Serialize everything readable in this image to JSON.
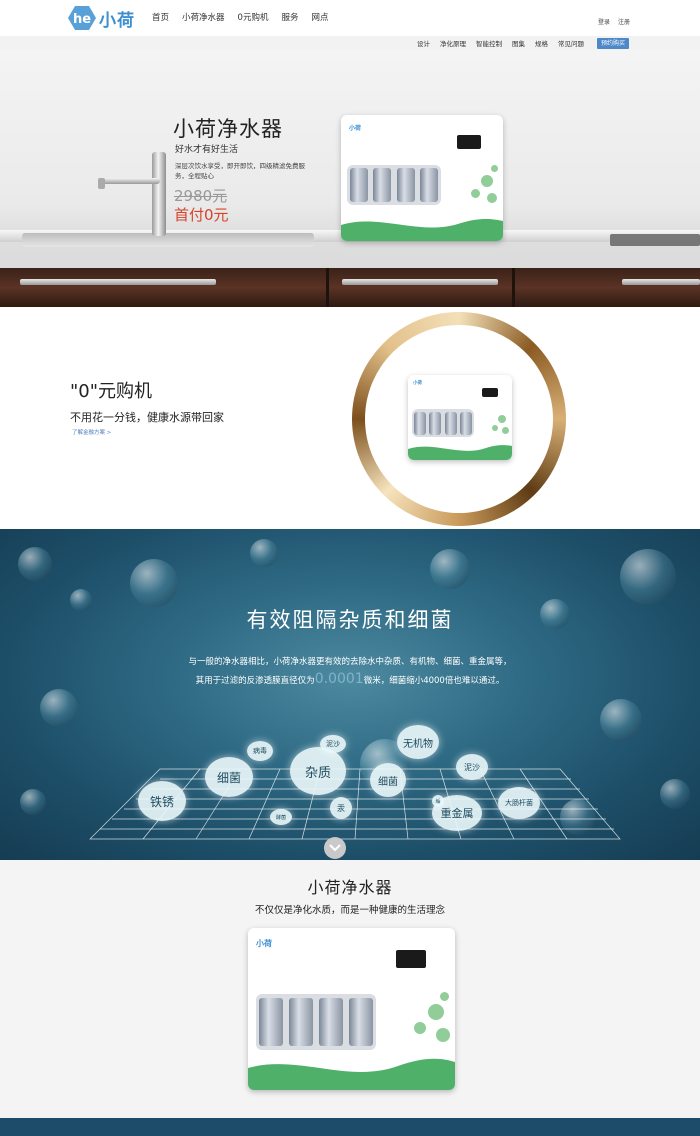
{
  "header": {
    "logo_text": "小荷",
    "nav": [
      "首页",
      "小荷净水器",
      "0元购机",
      "服务",
      "网点"
    ],
    "login": "登录",
    "register": "注册"
  },
  "subnav": {
    "items": [
      "设计",
      "净化原理",
      "智能控制",
      "图集",
      "规格",
      "常见问题"
    ],
    "book_button": "预约购买"
  },
  "hero": {
    "title": "小荷净水器",
    "subtitle": "好水才有好生活",
    "description": "深层次饮水享受，即开即饮，四级精滤免费服务，全程贴心",
    "price_old": "2980元",
    "price_new": "首付0元",
    "device_logo": "小荷"
  },
  "zero_buy": {
    "title": "\"0\"元购机",
    "subtitle": "不用花一分钱，健康水源带回家",
    "link": "了解金融方案 >",
    "device_logo": "小荷"
  },
  "filtration": {
    "title": "有效阻隔杂质和细菌",
    "desc_line1": "与一般的净水器相比，小荷净水器更有效的去除水中杂质、有机物、细菌、重金属等，",
    "desc_line2_a": "其用于过滤的反渗透膜直径仅为",
    "desc_line2_num": "0.0001",
    "desc_line2_b": "微米，细菌缩小4000倍也难以通过。",
    "labels": {
      "rust": "铁锈",
      "bacteria1": "细菌",
      "virus": "病毒",
      "impurity": "杂质",
      "silt1": "泥沙",
      "bacteria2": "细菌",
      "inorganic": "无机物",
      "silt2": "泥沙",
      "ecoli": "大肠杆菌",
      "mercury": "汞",
      "heavy_metal": "重金属",
      "scale": "垢",
      "yeast": "酵菌"
    }
  },
  "product": {
    "title": "小荷净水器",
    "subtitle": "不仅仅是净化水质，而是一种健康的生活理念",
    "device_logo": "小荷"
  },
  "colors": {
    "accent_blue": "#3d8fd0",
    "price_red": "#d6432a",
    "green": "#4fb06a",
    "deep_water": "#1d4e68"
  }
}
